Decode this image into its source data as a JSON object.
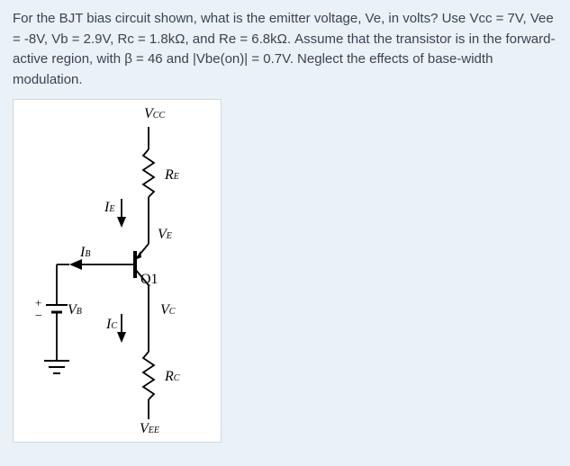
{
  "question": {
    "text": "For the BJT bias circuit shown, what is the emitter voltage, Ve, in volts? Use Vcc = 7V, Vee = -8V, Vb = 2.9V, Rc = 1.8kΩ, and Re = 6.8kΩ. Assume that the transistor is in the forward-active region, with β = 46 and |Vbe(on)| = 0.7V. Neglect the effects of base-width modulation."
  },
  "diagram": {
    "labels": {
      "vcc": "V",
      "vcc_sub": "CC",
      "re": "R",
      "re_sub": "E",
      "ie": "I",
      "ie_sub": "E",
      "ve": "V",
      "ve_sub": "E",
      "ib": "I",
      "ib_sub": "B",
      "q1": "Q1",
      "vb": "V",
      "vb_sub": "B",
      "ic": "I",
      "ic_sub": "C",
      "vc": "V",
      "vc_sub": "C",
      "rc": "R",
      "rc_sub": "C",
      "vee": "V",
      "vee_sub": "EE",
      "plus": "+",
      "minus": "−"
    }
  }
}
